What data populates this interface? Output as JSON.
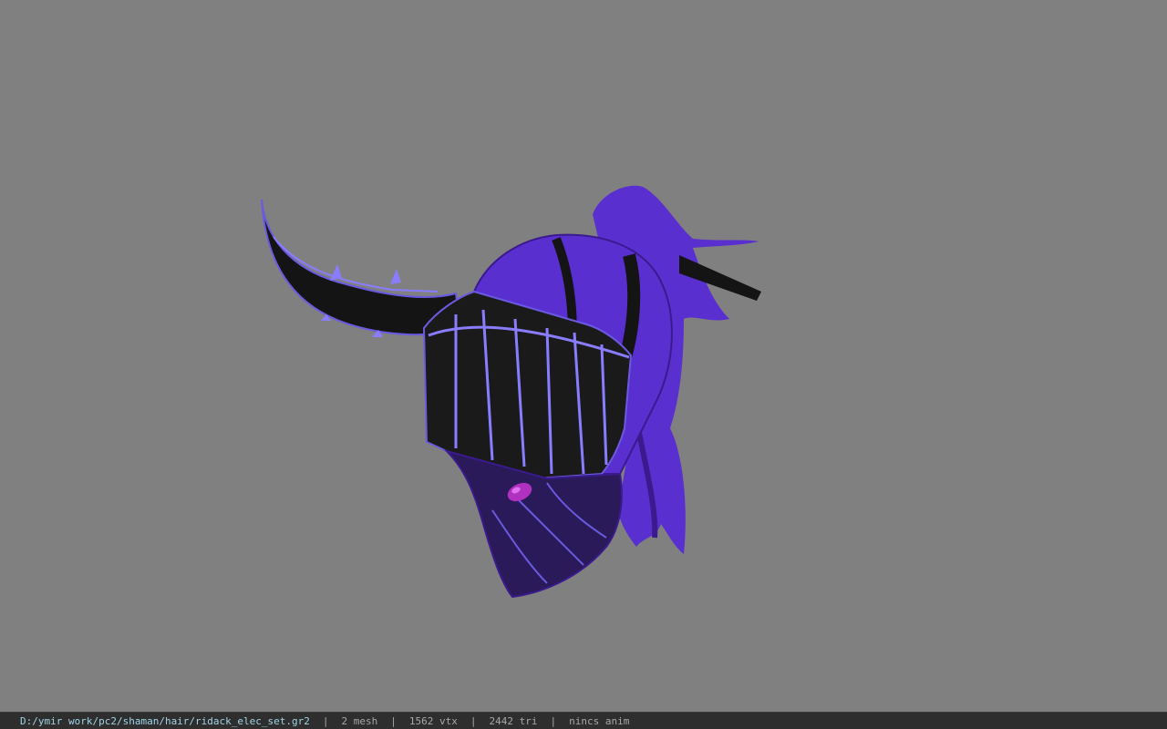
{
  "status": {
    "file_path": "D:/ymir work/pc2/shaman/hair/ridack_elec_set.gr2",
    "separator": "|",
    "mesh": "2 mesh",
    "vtx": "1562 vtx",
    "tri": "2442 tri",
    "anim": "nincs anim"
  },
  "viewport": {
    "background": "#808080",
    "model_colors": {
      "purple": "#5a2fd0",
      "dark_purple": "#3a1a8c",
      "black": "#141414",
      "glow": "#8a7cff",
      "magenta": "#b030c0"
    }
  }
}
